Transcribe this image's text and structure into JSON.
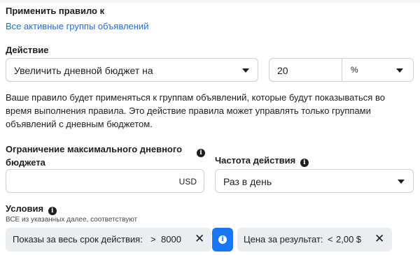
{
  "apply_rule": {
    "heading": "Применить правило к",
    "target_link": "Все активные группы объявлений"
  },
  "action": {
    "heading": "Действие",
    "selected": "Увеличить дневной бюджет на",
    "amount_value": "20",
    "unit": "%"
  },
  "description": "Ваше правило будет применяться к группам объявлений, которые будут показываться во время выполнения правила. Это действие правила может управлять только группами объявлений с дневным бюджетом.",
  "max_budget": {
    "label_line1": "Ограничение максимального дневного",
    "label_line2": "бюджета",
    "value": "",
    "currency": "USD"
  },
  "frequency": {
    "label": "Частота действия",
    "selected": "Раз в день"
  },
  "conditions": {
    "heading": "Условия",
    "subtitle": "ВСЕ из указанных далее, соответствуют",
    "chips": [
      {
        "label": "Показы за весь срок действия:",
        "operator": ">",
        "value": "8000"
      },
      {
        "label": "Цена за результат:",
        "operator": "<",
        "value": "2,00 $"
      }
    ]
  },
  "colors": {
    "accent": "#216fdb",
    "chip_bg": "#ebedf0",
    "info_button": "#1877f2"
  },
  "icons": [
    "caret-down-icon",
    "info-icon",
    "close-icon"
  ]
}
